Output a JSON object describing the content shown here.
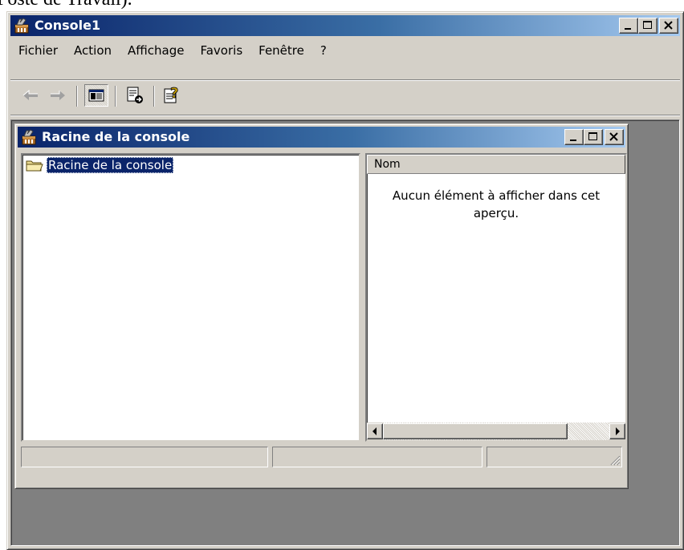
{
  "page_fragment": "Poste de Travail).",
  "window": {
    "title": "Console1",
    "controls": [
      "minimize",
      "maximize",
      "close"
    ]
  },
  "menu": {
    "items": [
      "Fichier",
      "Action",
      "Affichage",
      "Favoris",
      "Fenêtre",
      "?"
    ]
  },
  "toolbar": {
    "buttons": [
      "back-arrow-icon",
      "forward-arrow-icon",
      "show-hide-tree-icon",
      "export-list-icon",
      "help-icon"
    ],
    "show_hide_tree_pressed": true
  },
  "child_window": {
    "title": "Racine de la console"
  },
  "tree": {
    "root_label": "Racine de la console",
    "root_selected": true
  },
  "list": {
    "column_header": "Nom",
    "empty_message": "Aucun élément à afficher dans cet aperçu."
  },
  "colors": {
    "title_active_start": "#0a246a",
    "title_active_end": "#a6caf0",
    "face": "#d4d0c8",
    "mdi_background": "#808080"
  }
}
